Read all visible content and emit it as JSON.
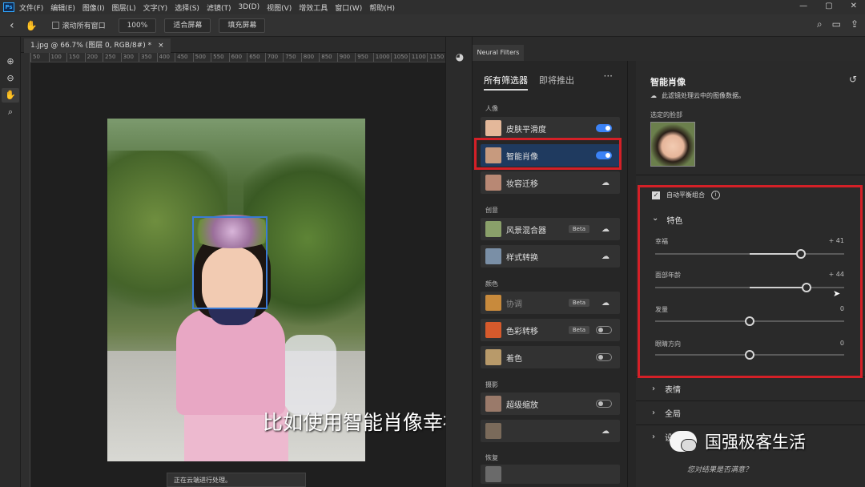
{
  "menubar": {
    "logo": "Ps",
    "items": [
      "文件(F)",
      "编辑(E)",
      "图像(I)",
      "图层(L)",
      "文字(Y)",
      "选择(S)",
      "滤镜(T)",
      "3D(D)",
      "视图(V)",
      "增效工具",
      "窗口(W)",
      "帮助(H)"
    ]
  },
  "options": {
    "scroll_all_label": "滚动所有窗口",
    "zoom_value": "100%",
    "fit_screen": "适合屏幕",
    "fill_screen": "填充屏幕"
  },
  "document": {
    "tab_title": "1.jpg @ 66.7% (图层 0, RGB/8#) *",
    "ruler_ticks": [
      "50",
      "100",
      "150",
      "200",
      "250",
      "300",
      "350",
      "400",
      "450",
      "500",
      "550",
      "600",
      "650",
      "700",
      "750",
      "800",
      "850",
      "900",
      "950",
      "1000",
      "1050",
      "1100",
      "1150"
    ],
    "status": "正在云端进行处理。",
    "subtitle": "比如使用智能肖像幸福面部年龄"
  },
  "neural_filters": {
    "tab_label": "Neural Filters",
    "tabs": [
      "所有筛选器",
      "即将推出"
    ],
    "more": "···",
    "categories": {
      "portrait": "人像",
      "creative": "创意",
      "color": "颜色",
      "photography": "摄影",
      "restore": "恢复"
    },
    "items": [
      {
        "label": "皮肤平滑度",
        "toggle": "on"
      },
      {
        "label": "智能肖像",
        "toggle": "on"
      },
      {
        "label": "妆容迁移",
        "toggle": "cloud"
      },
      {
        "label": "风景混合器",
        "beta": "Beta",
        "toggle": "cloud"
      },
      {
        "label": "样式转换",
        "toggle": "cloud"
      },
      {
        "label": "协调",
        "beta": "Beta",
        "toggle": "cloud"
      },
      {
        "label": "色彩转移",
        "beta": "Beta",
        "toggle": "off"
      },
      {
        "label": "着色",
        "toggle": "off"
      },
      {
        "label": "超级缩放",
        "toggle": "off"
      }
    ]
  },
  "settings": {
    "title": "智能肖像",
    "cloud_note": "此滤镜处理云中的图像数据。",
    "selected_face_label": "选定的脸部",
    "auto_balance": "自动平衡组合",
    "section_feature": "特色",
    "sliders": [
      {
        "label": "幸福",
        "value": "+ 41",
        "position": 0.77
      },
      {
        "label": "面部年龄",
        "value": "+ 44",
        "position": 0.8
      },
      {
        "label": "发量",
        "value": "0",
        "position": 0.5
      },
      {
        "label": "眼睛方向",
        "value": "0",
        "position": 0.5
      }
    ],
    "section_expression": "表情",
    "section_global": "全局",
    "section_settings": "设",
    "footer_question": "您对结果是否满意？"
  },
  "watermark": {
    "text": "国强极客生活"
  },
  "colors": {
    "highlight_red": "#d42027",
    "accent_blue": "#3b82f6"
  }
}
